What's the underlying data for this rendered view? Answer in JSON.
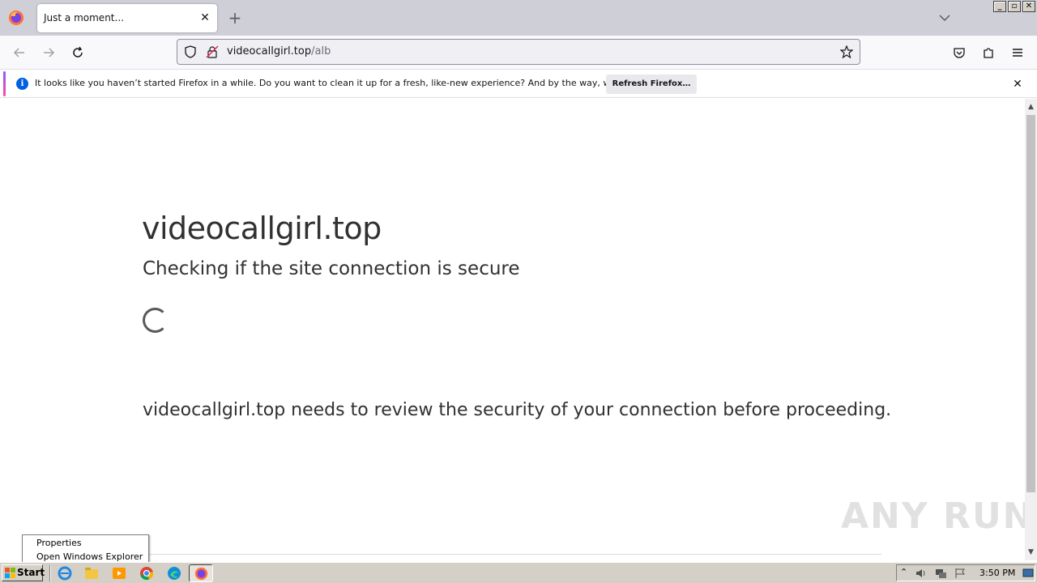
{
  "browser": {
    "tab": {
      "title": "Just a moment...",
      "close": "✕"
    },
    "newtab": "+",
    "url": {
      "host": "videocallgirl.top",
      "path": "/alb"
    },
    "window_controls": [
      "_",
      "▫",
      "✕"
    ]
  },
  "notification": {
    "text": "It looks like you haven’t started Firefox in a while. Do you want to clean it up for a fresh, like-new experience? And by the way, welcome back!",
    "button": "Refresh Firefox…",
    "close": "✕"
  },
  "page": {
    "heading": "videocallgirl.top",
    "subheading": "Checking if the site connection is secure",
    "message": "videocallgirl.top needs to review the security of your connection before proceeding."
  },
  "watermark": "ANY RUN",
  "context_menu": {
    "items": [
      "Properties",
      "Open Windows Explorer"
    ]
  },
  "taskbar": {
    "start": "Start",
    "icons": [
      "ie-icon",
      "explorer-icon",
      "media-player-icon",
      "chrome-icon",
      "edge-icon",
      "firefox-icon"
    ],
    "clock": "3:50 PM"
  },
  "colors": {
    "accent": "#0060df",
    "tabbar": "#cfcfd8",
    "text": "#313131"
  }
}
